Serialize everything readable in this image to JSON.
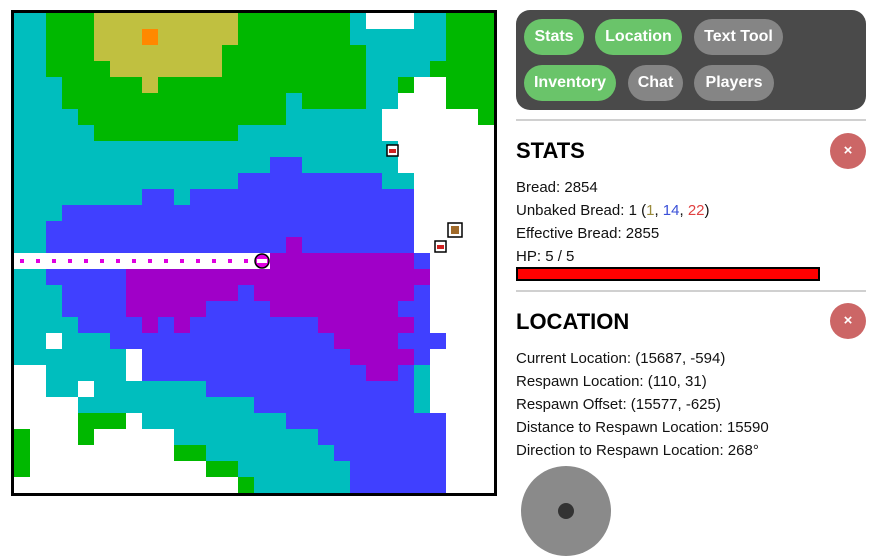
{
  "tabs": [
    {
      "label": "Stats",
      "active": true
    },
    {
      "label": "Location",
      "active": true
    },
    {
      "label": "Text Tool",
      "active": false
    },
    {
      "label": "Inventory",
      "active": true
    },
    {
      "label": "Chat",
      "active": false
    },
    {
      "label": "Players",
      "active": false
    }
  ],
  "stats": {
    "title": "STATS",
    "close_label": "×",
    "bread_label": "Bread:",
    "bread": "2854",
    "unbaked_label": "Unbaked Bread:",
    "unbaked": "1",
    "unbaked_breakdown": [
      "1",
      "14",
      "22"
    ],
    "effective_label": "Effective Bread:",
    "effective": "2855",
    "hp_label": "HP:",
    "hp_current": "5",
    "hp_max": "5",
    "hp_fraction": 1.0
  },
  "location": {
    "title": "LOCATION",
    "close_label": "×",
    "current_label": "Current Location:",
    "current": "(15687, -594)",
    "respawn_label": "Respawn Location:",
    "respawn": "(110, 31)",
    "offset_label": "Respawn Offset:",
    "offset": "(15577, -625)",
    "distance_label": "Distance to Respawn Location:",
    "distance": "15590",
    "direction_label": "Direction to Respawn Location:",
    "direction": "268°"
  },
  "colors": {
    "grass": "#00b800",
    "water": "#00bebe",
    "deep": "#4040ff",
    "purple": "#a000c8",
    "sand": "#c0c040",
    "snow": "#ffffff",
    "player": "#e000e0",
    "tab_active": "#6ac46a",
    "tab_inactive": "#858585",
    "close": "#cc6666",
    "hp": "#ff0000"
  }
}
